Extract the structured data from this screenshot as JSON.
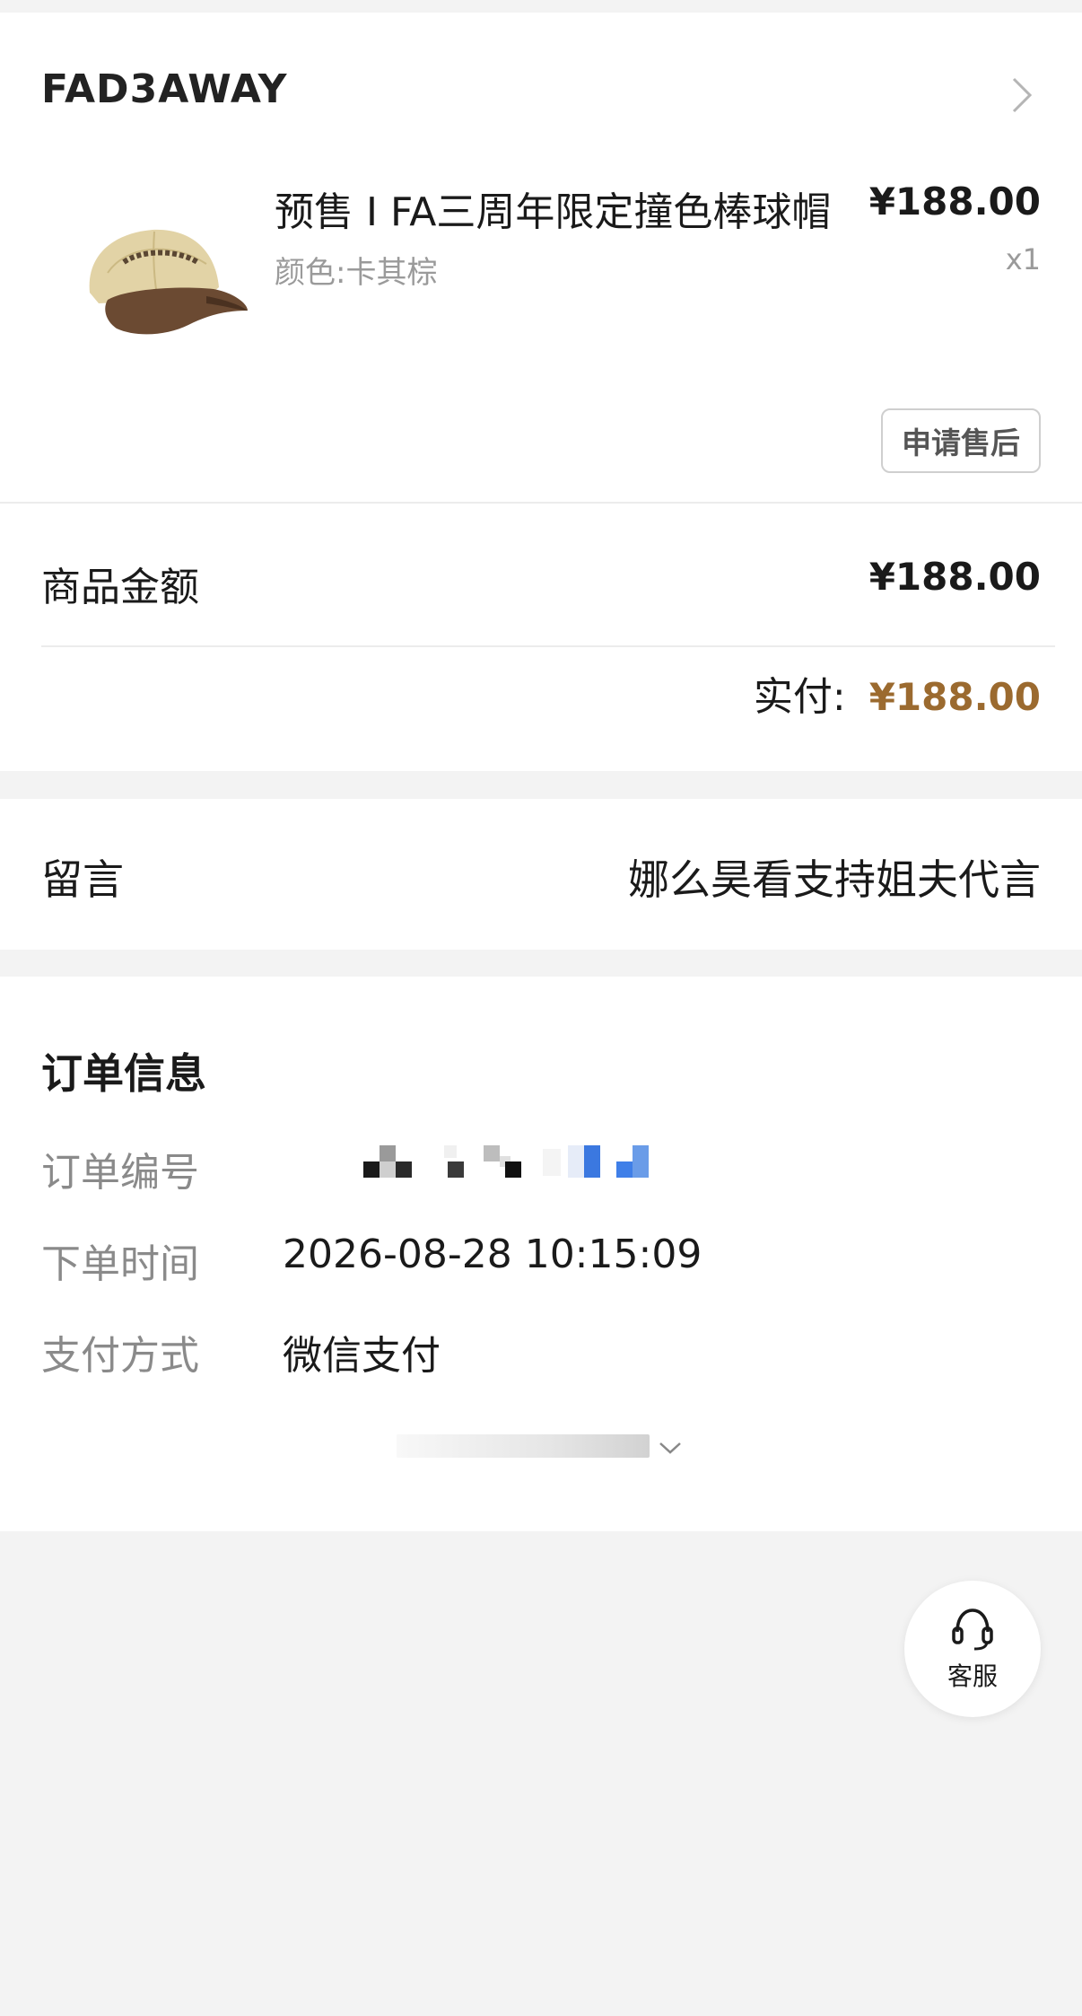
{
  "shop": {
    "name": "FAD3AWAY",
    "icon": "chevron-right-icon"
  },
  "product": {
    "title": "预售 I FA三周年限定撞色棒球帽",
    "variant": "颜色:卡其棕",
    "price": "¥188.00",
    "quantity": "x1",
    "after_sale_label": "申请售后"
  },
  "summary": {
    "subtotal_label": "商品金额",
    "subtotal_value": "¥188.00",
    "paid_label": "实付:",
    "paid_value": "¥188.00",
    "paid_color": "#9b6a2f"
  },
  "message": {
    "label": "留言",
    "value": "娜么昊看支持姐夫代言"
  },
  "order_info": {
    "heading": "订单信息",
    "order_number_label": "订单编号",
    "order_time_label": "下单时间",
    "order_time_value": "2026-08-28 10:15:09",
    "payment_label": "支付方式",
    "payment_value": "微信支付",
    "expand_icon": "chevron-down-icon"
  },
  "service": {
    "label": "客服",
    "icon": "headset-icon"
  }
}
